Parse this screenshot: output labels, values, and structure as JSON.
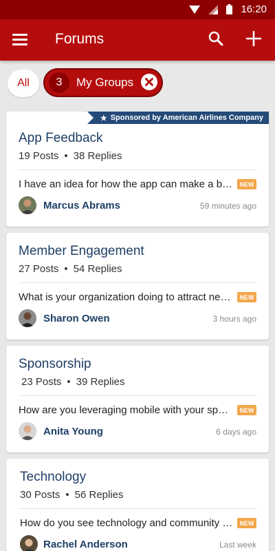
{
  "status_bar": {
    "time": "16:20",
    "icons": [
      "wifi-icon",
      "signal-icon",
      "battery-icon"
    ]
  },
  "app_bar": {
    "title": "Forums",
    "menu_icon": "menu-icon",
    "search_icon": "search-icon",
    "add_icon": "plus-icon"
  },
  "filters": {
    "all_label": "All",
    "groups_count": "3",
    "groups_label": "My Groups",
    "clear_icon": "close-icon"
  },
  "theme": {
    "primary": "#b50d0d",
    "dark": "#8e0000",
    "title_blue": "#1e3f66",
    "badge": "#f3a64a",
    "sponsor_bg": "#244a78"
  },
  "forums": [
    {
      "title": "App Feedback",
      "posts": "19 Posts",
      "replies": "38 Replies",
      "sponsor": "Sponsored by American Airlines Company",
      "snippet": "I have an idea for how the app can make a big difference",
      "badge": "NEW",
      "author": "Marcus Abrams",
      "time": "59 minutes ago"
    },
    {
      "title": "Member Engagement",
      "posts": "27 Posts",
      "replies": "54 Replies",
      "snippet": "What is your organization doing to attract new members",
      "badge": "NEW",
      "author": "Sharon Owen",
      "time": "3 hours ago"
    },
    {
      "title": "Sponsorship",
      "posts": "23 Posts",
      "replies": "39 Replies",
      "snippet": "How are you leveraging mobile with your sponsors",
      "badge": "NEW",
      "author": "Anita Young",
      "time": "6 days ago"
    },
    {
      "title": "Technology",
      "posts": "30 Posts",
      "replies": "56 Replies",
      "snippet": "How do you see technology and community coming together",
      "badge": "NEW",
      "author": "Rachel Anderson",
      "time": "Last week"
    }
  ]
}
